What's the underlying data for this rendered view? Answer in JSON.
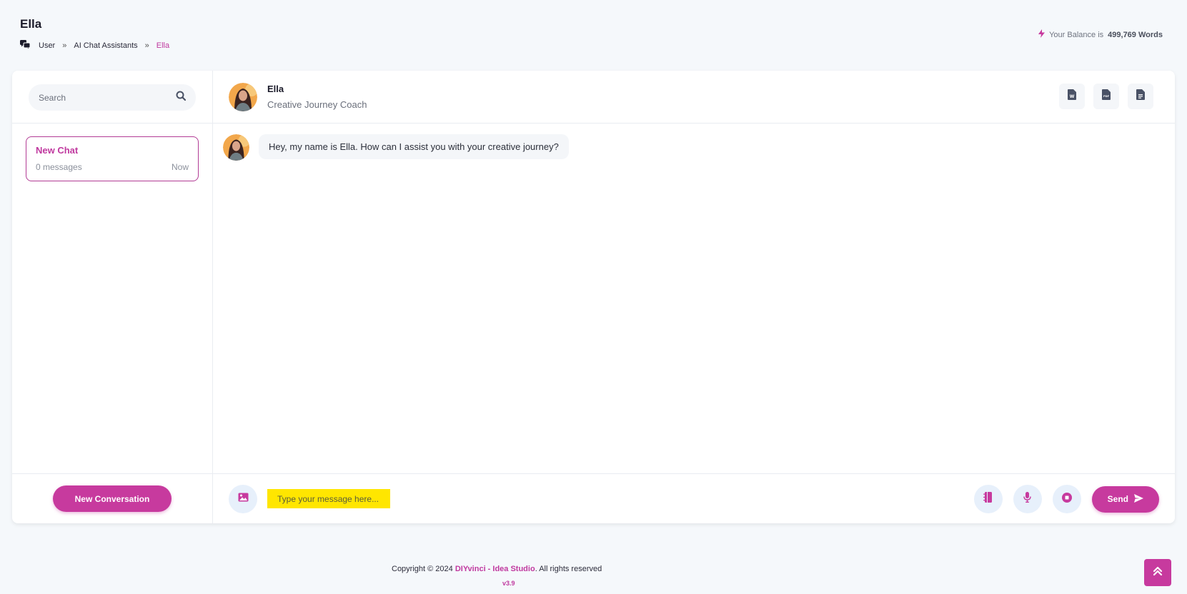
{
  "page": {
    "title": "Ella",
    "breadcrumb": [
      "User",
      "AI Chat Assistants",
      "Ella"
    ],
    "breadcrumb_sep": "»"
  },
  "balance": {
    "prefix": "Your Balance is",
    "value": "499,769 Words"
  },
  "sidebar": {
    "search_placeholder": "Search",
    "conversations": [
      {
        "title": "New Chat",
        "messages": "0 messages",
        "time": "Now"
      }
    ],
    "new_conversation_label": "New Conversation"
  },
  "chat": {
    "assistant_name": "Ella",
    "assistant_role": "Creative Journey Coach",
    "messages": [
      {
        "text": "Hey, my name is Ella. How can I assist you with your creative journey?"
      }
    ],
    "input_placeholder": "Type your message here...",
    "send_label": "Send"
  },
  "footer": {
    "copyright_prefix": "Copyright © 2024",
    "brand": "DIYvinci - Idea Studio",
    "copyright_suffix": ". All rights reserved",
    "version": "v3.9"
  },
  "colors": {
    "accent": "#c73a9e",
    "highlight_input": "#ffe600"
  }
}
